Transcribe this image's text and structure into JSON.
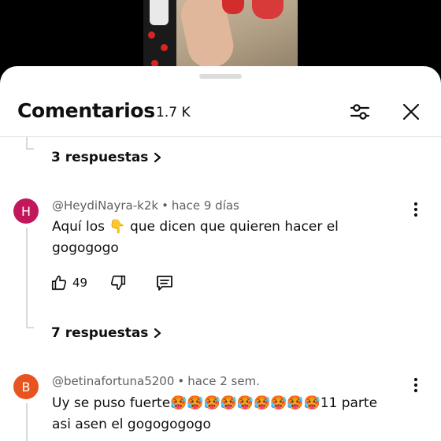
{
  "header": {
    "title": "Comentarios",
    "count": "1.7 K"
  },
  "thread_top": {
    "replies_label": "3 respuestas"
  },
  "comments": [
    {
      "avatar_letter": "H",
      "avatar_color": "#c2185b",
      "author": "@HeydiNayra-k2k",
      "time": "hace 9 días",
      "text": "Aquí los 👇 que dicen que quieren hacer el gogogogo",
      "likes": "49",
      "replies_label": "7 respuestas"
    },
    {
      "avatar_letter": "B",
      "avatar_color": "#e8541f",
      "author": "@betinafortuna5200",
      "time": "hace 2 sem.",
      "text": "Uy se puso fuerte🥵🥵🥵🥵🥵🥵🥵🥵🥵11 parte asi asen el gogogogogo"
    }
  ]
}
